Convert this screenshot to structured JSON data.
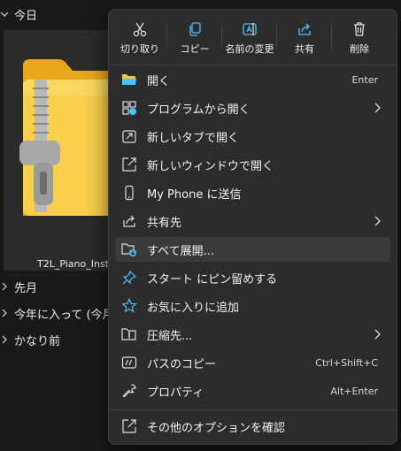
{
  "explorer": {
    "groups": {
      "today": "今日",
      "last_month": "先月",
      "earlier_this_year": "今年に入って (今月",
      "long_ago": "かなり前"
    },
    "file_name": "T2L_Piano_Inst"
  },
  "toolbar": {
    "cut": "切り取り",
    "copy": "コピー",
    "rename": "名前の変更",
    "share": "共有",
    "delete": "削除"
  },
  "menu": {
    "open": {
      "label": "開く",
      "shortcut": "Enter"
    },
    "open_with": {
      "label": "プログラムから開く"
    },
    "open_new_tab": {
      "label": "新しいタブで開く"
    },
    "open_new_window": {
      "label": "新しいウィンドウで開く"
    },
    "send_to_phone": {
      "label": "My Phone に送信"
    },
    "share_with": {
      "label": "共有先"
    },
    "extract_all": {
      "label": "すべて展開..."
    },
    "pin_start": {
      "label": "スタート にピン留めする"
    },
    "add_favorites": {
      "label": "お気に入りに追加"
    },
    "compress": {
      "label": "圧縮先..."
    },
    "copy_path": {
      "label": "パスのコピー",
      "shortcut": "Ctrl+Shift+C"
    },
    "properties": {
      "label": "プロパティ",
      "shortcut": "Alt+Enter"
    },
    "more_options": {
      "label": "その他のオプションを確認"
    }
  },
  "colors": {
    "accent": "#4cc2ff",
    "folder_yellow": "#f5c342",
    "menu_bg": "#2c2c2c",
    "hover_bg": "#3a3a3a"
  }
}
